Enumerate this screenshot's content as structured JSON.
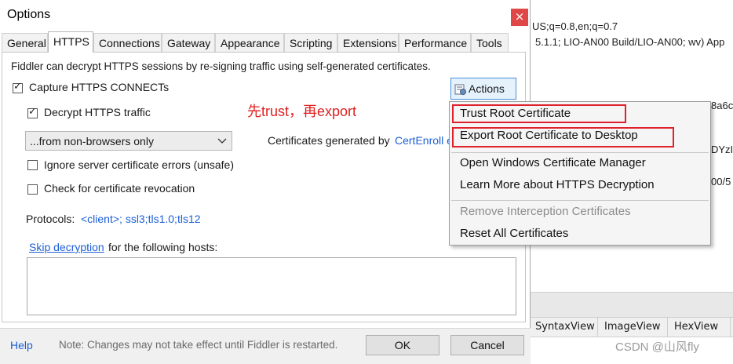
{
  "background": {
    "lines": [
      "US;q=0.8,en;q=0.7",
      "5.1.1; LIO-AN00 Build/LIO-AN00; wv) App",
      "8a6c",
      "DYzIi",
      "00/5"
    ],
    "tabs": [
      "SyntaxView",
      "ImageView",
      "HexView"
    ],
    "watermark": "CSDN @山风fly"
  },
  "dialog": {
    "title": "Options",
    "close": "×",
    "tabs": [
      "General",
      "HTTPS",
      "Connections",
      "Gateway",
      "Appearance",
      "Scripting",
      "Extensions",
      "Performance",
      "Tools"
    ],
    "active_tab": "HTTPS",
    "intro": "Fiddler can decrypt HTTPS sessions by re-signing traffic using self-generated certificates.",
    "capture_label": "Capture HTTPS CONNECTs",
    "decrypt_label": "Decrypt HTTPS traffic",
    "dropdown_value": "...from non-browsers only",
    "cert_text": "Certificates generated by",
    "cert_link": "CertEnroll e",
    "ignore_label": "Ignore server certificate errors (unsafe)",
    "revocation_label": "Check for certificate revocation",
    "protocols_label": "Protocols:",
    "protocols_value": "<client>; ssl3;tls1.0;tls12",
    "skip_link": "Skip decryption",
    "skip_text": "for the following hosts:",
    "actions_label": "Actions",
    "annotation": "先trust，再export"
  },
  "menu": {
    "items": [
      "Trust Root Certificate",
      "Export Root Certificate to Desktop",
      "Open Windows Certificate Manager",
      "Learn More about HTTPS Decryption",
      "Remove Interception Certificates",
      "Reset All Certificates"
    ]
  },
  "footer": {
    "help": "Help",
    "note": "Note: Changes may not take effect until Fiddler is restarted.",
    "ok": "OK",
    "cancel": "Cancel"
  },
  "colors": {
    "link": "#1c5fd6",
    "annotation": "#e02020",
    "highlight": "#e0202a",
    "close": "#e04848"
  }
}
